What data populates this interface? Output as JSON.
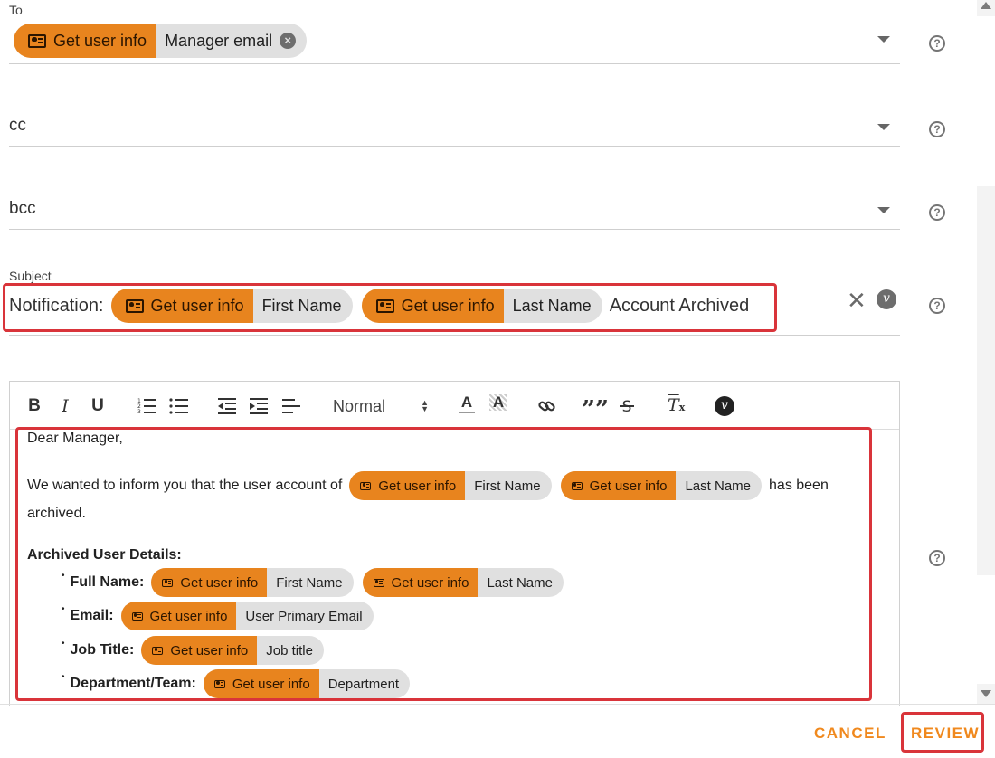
{
  "to": {
    "label": "To",
    "chip": {
      "source": "Get user info",
      "field": "Manager email"
    }
  },
  "cc": {
    "label": "cc"
  },
  "bcc": {
    "label": "bcc"
  },
  "subject": {
    "label": "Subject",
    "prefix": "Notification:",
    "chips": [
      {
        "source": "Get user info",
        "field": "First Name"
      },
      {
        "source": "Get user info",
        "field": "Last Name"
      }
    ],
    "suffix": "Account Archived"
  },
  "toolbar": {
    "bold": "B",
    "italic": "I",
    "underline": "U",
    "style_select": "Normal",
    "quote": "””",
    "clear": "T"
  },
  "body": {
    "greeting": "Dear Manager,",
    "intro": "We wanted to inform you that the user account of",
    "intro_chips": [
      {
        "source": "Get user info",
        "field": "First Name"
      },
      {
        "source": "Get user info",
        "field": "Last Name"
      }
    ],
    "intro_end": "has been",
    "intro_end2": "archived.",
    "details_heading": "Archived User Details:",
    "details": [
      {
        "label": "Full Name:",
        "chips": [
          {
            "source": "Get user info",
            "field": "First Name"
          },
          {
            "source": "Get user info",
            "field": "Last Name"
          }
        ]
      },
      {
        "label": "Email:",
        "chips": [
          {
            "source": "Get user info",
            "field": "User Primary Email"
          }
        ]
      },
      {
        "label": "Job Title:",
        "chips": [
          {
            "source": "Get user info",
            "field": "Job title"
          }
        ]
      },
      {
        "label": "Department/Team:",
        "chips": [
          {
            "source": "Get user info",
            "field": "Department"
          }
        ]
      }
    ]
  },
  "footer": {
    "cancel": "CANCEL",
    "review": "REVIEW"
  },
  "colors": {
    "accent": "#e8841e",
    "highlight": "#d9343a",
    "chip_bg": "#e0e0e0"
  },
  "icons": [
    "user-card-icon",
    "help-icon",
    "close-icon",
    "variable-icon",
    "dropdown-arrow-icon"
  ]
}
